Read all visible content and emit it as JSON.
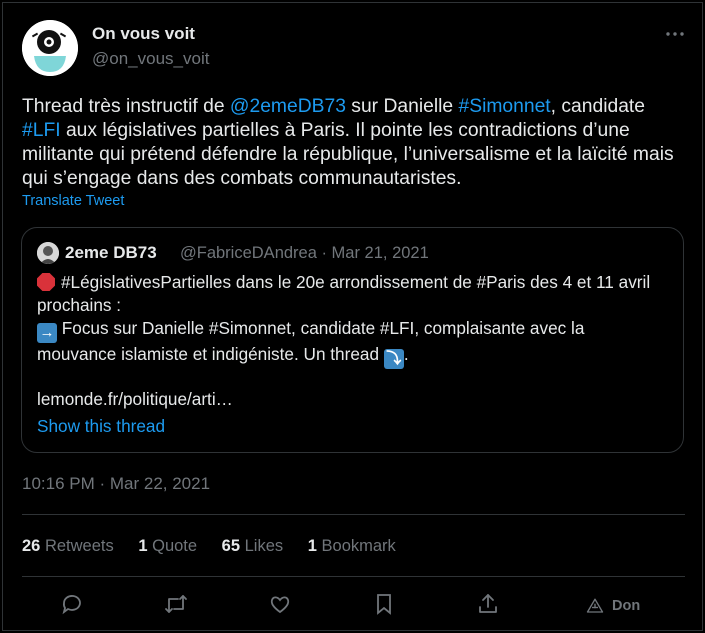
{
  "author": {
    "name": "On vous voit",
    "handle": "@on_vous_voit",
    "avatar_icon": "surveillance-eye-logo-icon"
  },
  "tweet": {
    "segments": [
      {
        "t": "Thread très instructif de ",
        "link": false
      },
      {
        "t": "@2emeDB73",
        "link": true
      },
      {
        "t": " sur Danielle ",
        "link": false
      },
      {
        "t": "#Simonnet",
        "link": true
      },
      {
        "t": ", candidate ",
        "link": false
      },
      {
        "t": "#LFI",
        "link": true
      },
      {
        "t": " aux législatives partielles à Paris. Il pointe les contradictions d’une militante qui prétend défendre la république, l’universalisme et la laïcité mais qui s’engage dans des combats communautaristes.",
        "link": false
      }
    ],
    "translate_label": "Translate Tweet",
    "timestamp": "10:16 PM · Mar 22, 2021"
  },
  "quote": {
    "name": "2eme DB73",
    "meta": "@FabriceDAndrea · Mar 21, 2021",
    "line1": "#LégislativesPartielles dans le 20e arrondissement de #Paris des 4 et 11 avril prochains :",
    "line2": "Focus sur Danielle #Simonnet, candidate #LFI, complaisante avec la mouvance islamiste et indigéniste. Un thread",
    "line2_end": ".",
    "url": "lemonde.fr/politique/arti…",
    "show_thread": "Show this thread"
  },
  "stats": {
    "retweets_count": "26",
    "retweets_label": "Retweets",
    "quotes_count": "1",
    "quotes_label": "Quote",
    "likes_count": "65",
    "likes_label": "Likes",
    "bookmarks_count": "1",
    "bookmarks_label": "Bookmark"
  },
  "actions": {
    "donate_label": "Don"
  },
  "colors": {
    "accent": "#1d9bf0",
    "muted": "#71767b",
    "text": "#e7e9ea",
    "border": "#2f3336",
    "background": "#000000"
  }
}
